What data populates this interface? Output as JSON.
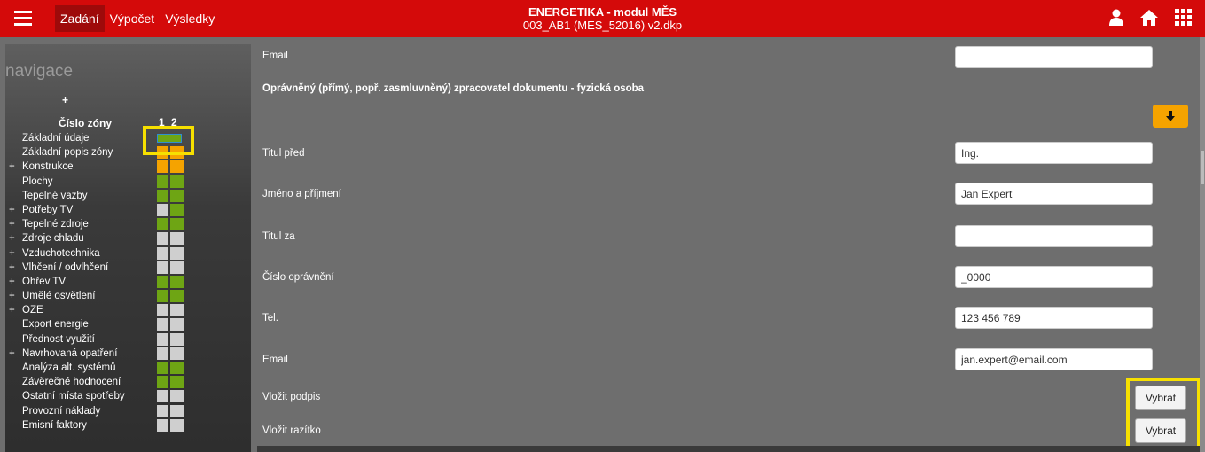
{
  "topbar": {
    "tabs": [
      "Zadání",
      "Výpočet",
      "Výsledky"
    ],
    "active_tab": "Zadání",
    "title": "ENERGETIKA - modul MĚS",
    "subtitle": "003_AB1 (MES_52016) v2.dkp",
    "icons": [
      "menu-icon",
      "user-icon",
      "home-icon",
      "apps-grid-icon"
    ]
  },
  "sidebar": {
    "title": "navigace",
    "plus": "+",
    "zone_label": "Číslo zóny",
    "zone_numbers": "1 2",
    "items": [
      {
        "prefix": "",
        "label": "Základní údaje",
        "status": [
          "selected"
        ]
      },
      {
        "prefix": "",
        "label": "Základní popis zóny",
        "status": [
          "orange",
          "orange"
        ]
      },
      {
        "prefix": "+",
        "label": "Konstrukce",
        "status": [
          "orange",
          "orange"
        ]
      },
      {
        "prefix": "",
        "label": "Plochy",
        "status": [
          "green",
          "green"
        ]
      },
      {
        "prefix": "",
        "label": "Tepelné vazby",
        "status": [
          "green",
          "green"
        ]
      },
      {
        "prefix": "+",
        "label": "Potřeby TV",
        "status": [
          "grey",
          "green"
        ]
      },
      {
        "prefix": "+",
        "label": "Tepelné zdroje",
        "status": [
          "green",
          "green"
        ]
      },
      {
        "prefix": "+",
        "label": "Zdroje chladu",
        "status": [
          "grey",
          "grey"
        ]
      },
      {
        "prefix": "+",
        "label": "Vzduchotechnika",
        "status": [
          "grey",
          "grey"
        ]
      },
      {
        "prefix": "+",
        "label": "Vlhčení / odvlhčení",
        "status": [
          "grey",
          "grey"
        ]
      },
      {
        "prefix": "+",
        "label": "Ohřev TV",
        "status": [
          "green",
          "green"
        ]
      },
      {
        "prefix": "+",
        "label": "Umělé osvětlení",
        "status": [
          "green",
          "green"
        ]
      },
      {
        "prefix": "+",
        "label": "OZE",
        "status": [
          "grey",
          "grey"
        ]
      },
      {
        "prefix": "",
        "label": "Export energie",
        "status": [
          "grey",
          "grey"
        ]
      },
      {
        "prefix": "",
        "label": "Přednost využití",
        "status": [
          "grey",
          "grey"
        ]
      },
      {
        "prefix": "+",
        "label": "Navrhovaná opatření",
        "status": [
          "grey",
          "grey"
        ]
      },
      {
        "prefix": "",
        "label": "Analýza alt. systémů",
        "status": [
          "green",
          "green"
        ]
      },
      {
        "prefix": "",
        "label": "Závěrečné hodnocení",
        "status": [
          "green",
          "green"
        ]
      },
      {
        "prefix": "",
        "label": "Ostatní místa spotřeby",
        "status": [
          "grey",
          "grey"
        ]
      },
      {
        "prefix": "",
        "label": "Provozní náklady",
        "status": [
          "grey",
          "grey"
        ]
      },
      {
        "prefix": "",
        "label": "Emisní faktory",
        "status": [
          "grey",
          "grey"
        ]
      }
    ]
  },
  "main": {
    "email_top_label": "Email",
    "email_top_value": "",
    "section_title": "Oprávněný (přímý, popř. zasmluvněný) zpracovatel dokumentu - fyzická osoba",
    "fields": [
      {
        "label": "Titul před",
        "value": "Ing."
      },
      {
        "label": "Jméno a příjmení",
        "value": "Jan Expert"
      },
      {
        "label": "Titul za",
        "value": ""
      },
      {
        "label": "Číslo oprávnění",
        "value": "_0000"
      },
      {
        "label": "Tel.",
        "value": "123 456 789"
      },
      {
        "label": "Email",
        "value": "jan.expert@email.com"
      }
    ],
    "signature_label": "Vložit podpis",
    "stamp_label": "Vložit razítko",
    "select_button": "Vybrat",
    "colors": {
      "accent": "#d40a0a",
      "status_ok": "#6ea514",
      "status_warn": "#f5a300",
      "status_empty": "#cfcfcf"
    }
  }
}
